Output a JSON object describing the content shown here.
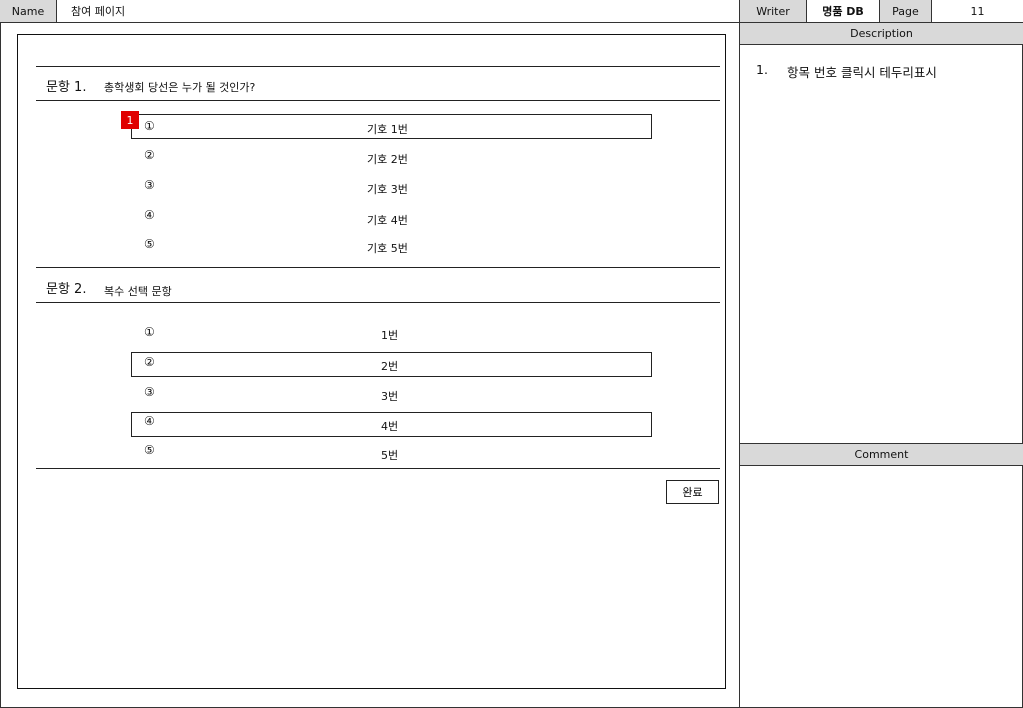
{
  "header": {
    "name_label": "Name",
    "name_value": "참여 페이지",
    "writer_label": "Writer",
    "writer_value": "명품 DB",
    "page_label": "Page",
    "page_value": "11"
  },
  "description": {
    "title": "Description",
    "items": [
      {
        "num": "1.",
        "text": "항목 번호 클릭시 테두리표시"
      }
    ]
  },
  "comment": {
    "title": "Comment"
  },
  "marker": "1",
  "questions": [
    {
      "label": "문항 1.",
      "text": "총학생회 당선은 누가 될 것인가?",
      "options": [
        {
          "num": "①",
          "text": "기호 1번",
          "selected": true
        },
        {
          "num": "②",
          "text": "기호 2번",
          "selected": false
        },
        {
          "num": "③",
          "text": "기호 3번",
          "selected": false
        },
        {
          "num": "④",
          "text": "기호 4번",
          "selected": false
        },
        {
          "num": "⑤",
          "text": "기호 5번",
          "selected": false
        }
      ]
    },
    {
      "label": "문항 2.",
      "text": "복수 선택 문항",
      "options": [
        {
          "num": "①",
          "text": "1번",
          "selected": false
        },
        {
          "num": "②",
          "text": "2번",
          "selected": true
        },
        {
          "num": "③",
          "text": "3번",
          "selected": false
        },
        {
          "num": "④",
          "text": "4번",
          "selected": true
        },
        {
          "num": "⑤",
          "text": "5번",
          "selected": false
        }
      ]
    }
  ],
  "done_button": "완료"
}
